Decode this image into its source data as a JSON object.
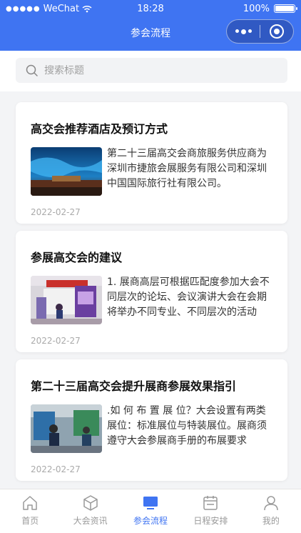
{
  "status": {
    "carrier": "WeChat",
    "time": "18:28",
    "battery": "100%"
  },
  "nav": {
    "title": "参会流程"
  },
  "search": {
    "placeholder": "搜索标题"
  },
  "articles": [
    {
      "title": "高交会推荐酒店及预订方式",
      "desc": "第二十三届高交会商旅服务供应商为深圳市捷旅会展服务有限公司和深圳中国国际旅行社有限公司。",
      "date": "2022-02-27",
      "thumb": "stage-photo"
    },
    {
      "title": "参展高交会的建议",
      "desc": "1. 展商高层可根据匹配度参加大会不同层次的论坛、会议演讲大会在会期将举办不同专业、不同层次的活动",
      "date": "2022-02-27",
      "thumb": "booth-photo"
    },
    {
      "title": "第二十三届高交会提升展商参展效果指引",
      "desc": ".如 何 布 置 展 位？大会设置有两类展位：标准展位与特装展位。展商须遵守大会参展商手册的布展要求",
      "date": "2022-02-27",
      "thumb": "exhibition-photo"
    }
  ],
  "tabs": [
    {
      "label": "首页",
      "icon": "home-icon",
      "active": false
    },
    {
      "label": "大会资讯",
      "icon": "cube-icon",
      "active": false
    },
    {
      "label": "参会流程",
      "icon": "monitor-icon",
      "active": true
    },
    {
      "label": "日程安排",
      "icon": "calendar-icon",
      "active": false
    },
    {
      "label": "我的",
      "icon": "user-icon",
      "active": false
    }
  ],
  "colors": {
    "primary": "#3f74f2",
    "background": "#f3f4f6"
  }
}
